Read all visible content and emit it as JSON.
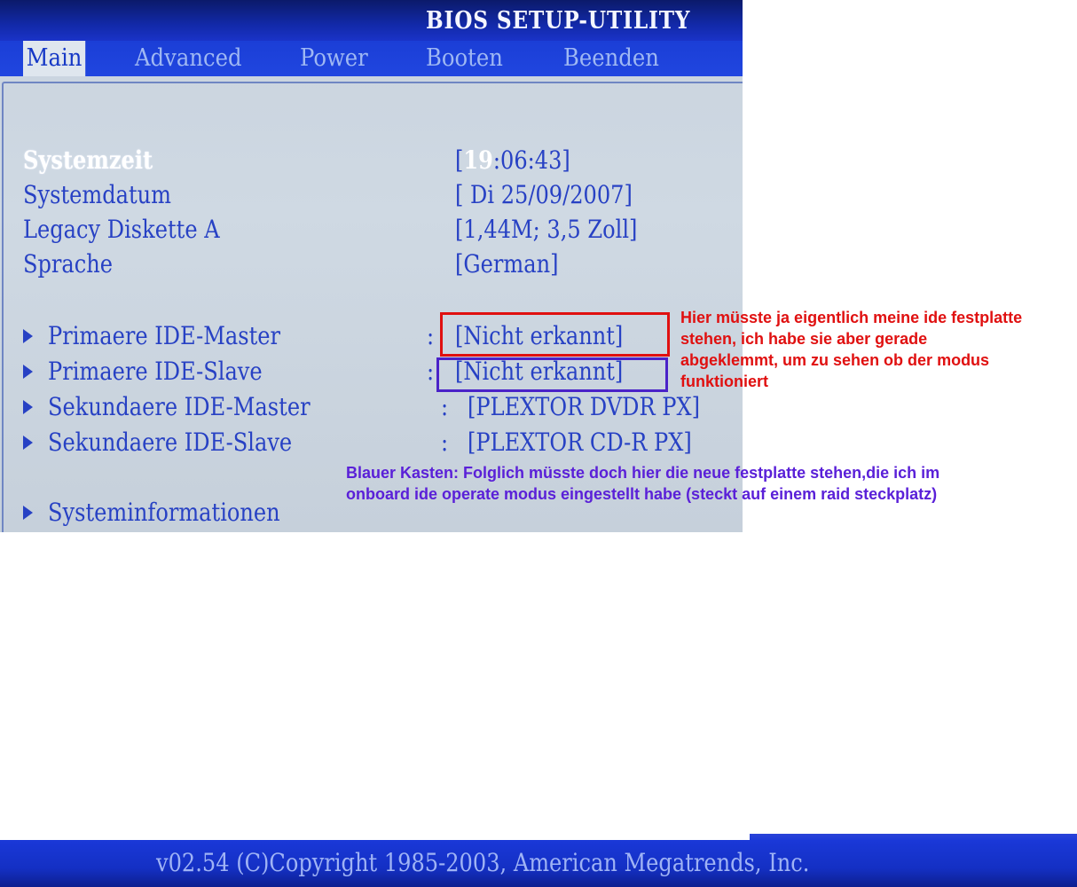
{
  "bios": {
    "title": "BIOS SETUP-UTILITY",
    "menu": [
      {
        "label": "Main",
        "active": true
      },
      {
        "label": "Advanced",
        "active": false
      },
      {
        "label": "Power",
        "active": false
      },
      {
        "label": "Booten",
        "active": false
      },
      {
        "label": "Beenden",
        "active": false
      }
    ],
    "settings": [
      {
        "label": "Systemzeit",
        "value_hour": "19",
        "value_rest": ":06:43]",
        "value_open": "[",
        "selected": true
      },
      {
        "label": "Systemdatum",
        "value": "[ Di 25/09/2007]"
      },
      {
        "label": "Legacy Diskette A",
        "value": "[1,44M; 3,5 Zoll]"
      },
      {
        "label": "Sprache",
        "value": "[German]"
      }
    ],
    "drives": [
      {
        "label": "Primaere IDE-Master",
        "value": "[Nicht erkannt]"
      },
      {
        "label": "Primaere IDE-Slave",
        "value": "[Nicht erkannt]"
      },
      {
        "label": "Sekundaere IDE-Master",
        "value": "[PLEXTOR DVDR   PX]"
      },
      {
        "label": "Sekundaere IDE-Slave",
        "value": "[PLEXTOR CD-R   PX]"
      }
    ],
    "separator": ":",
    "sysinfo": "Systeminformationen",
    "copyright": "v02.54 (C)Copyright 1985-2003, American Megatrends, Inc."
  },
  "annotations": {
    "red": [
      "Hier müsste ja eigentlich meine ide festplatte",
      "stehen, ich habe sie aber gerade",
      "abgeklemmt, um zu sehen ob der modus",
      "funktioniert"
    ],
    "blue": [
      "Blauer Kasten: Folglich müsste doch hier die neue festplatte stehen,die ich im",
      "onboard ide operate modus eingestellt habe (steckt auf einem raid steckplatz)"
    ]
  },
  "colors": {
    "bios_text": "#2741c4",
    "bios_background": "#cfd9e3",
    "menubar": "#1b3ed6",
    "red_annotation": "#e01010",
    "blue_annotation": "#5a20d8"
  }
}
